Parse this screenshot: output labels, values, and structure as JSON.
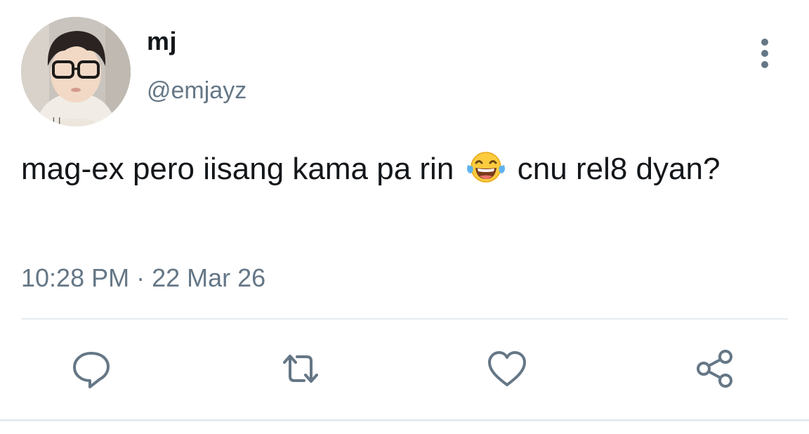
{
  "user": {
    "display_name": "mj",
    "handle": "@emjayz"
  },
  "tweet": {
    "text_before_emoji": "mag-ex pero iisang kama pa rin",
    "emoji": "face-with-tears-of-joy",
    "text_after_emoji": "cnu rel8 dyan?",
    "time": "10:28 PM",
    "separator": "·",
    "date": "22 Mar 26"
  },
  "icons": {
    "more": "more-vertical-icon",
    "reply": "reply-icon",
    "retweet": "retweet-icon",
    "like": "heart-icon",
    "share": "share-icon"
  },
  "colors": {
    "text": "#14171a",
    "muted": "#657786",
    "divider": "#e6ecf0"
  }
}
